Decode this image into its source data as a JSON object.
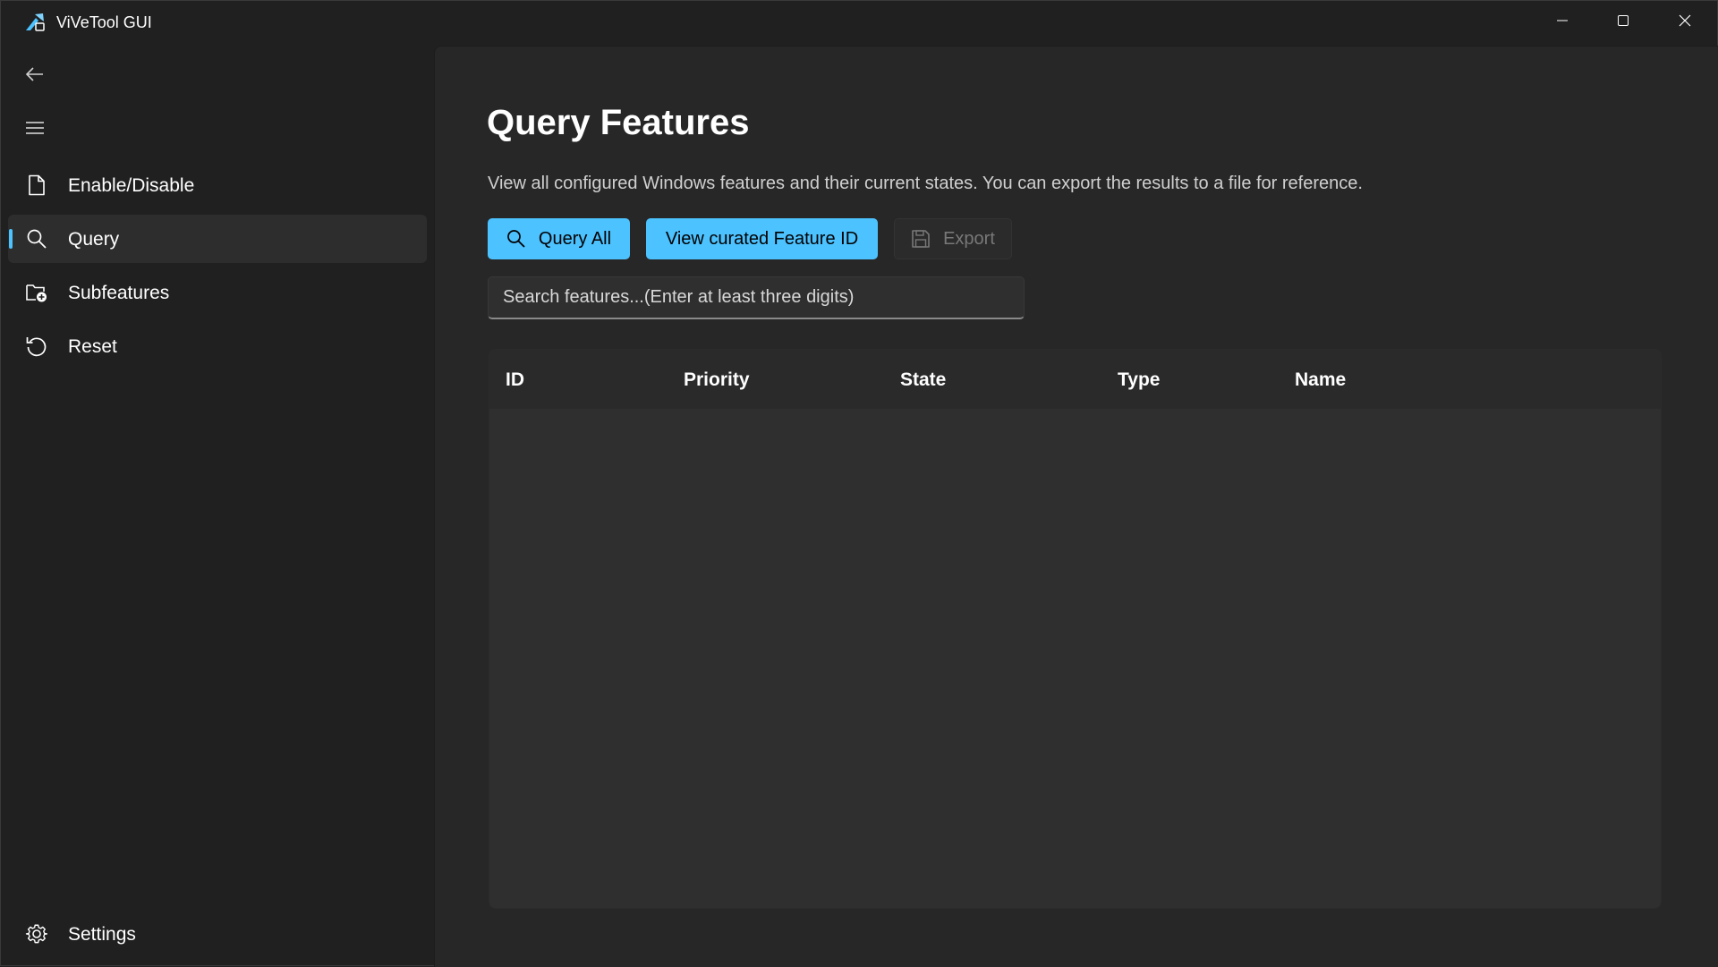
{
  "window": {
    "title": "ViVeTool GUI",
    "app_icon": "vivetool-app-icon",
    "caption_buttons": [
      "minimize-icon",
      "maximize-icon",
      "close-icon"
    ]
  },
  "sidebar": {
    "back_icon": "back-arrow-icon",
    "menu_icon": "hamburger-menu-icon",
    "items": [
      {
        "label": "Enable/Disable",
        "icon": "document-icon",
        "selected": false
      },
      {
        "label": "Query",
        "icon": "search-icon",
        "selected": true
      },
      {
        "label": "Subfeatures",
        "icon": "folder-add-icon",
        "selected": false
      },
      {
        "label": "Reset",
        "icon": "reset-icon",
        "selected": false
      }
    ],
    "settings": {
      "label": "Settings",
      "icon": "gear-icon"
    }
  },
  "main": {
    "title": "Query Features",
    "description": "View all configured Windows features and their current states. You can export the results to a file for reference.",
    "buttons": {
      "query_all": "Query All",
      "view_curated": "View curated Feature ID",
      "export": "Export"
    },
    "search": {
      "placeholder": "Search features...(Enter at least three digits)",
      "value": ""
    },
    "table": {
      "columns": [
        "ID",
        "Priority",
        "State",
        "Type",
        "Name"
      ],
      "rows": []
    }
  },
  "colors": {
    "accent": "#4cc2ff",
    "background": "#202020",
    "content_background": "#272727"
  }
}
